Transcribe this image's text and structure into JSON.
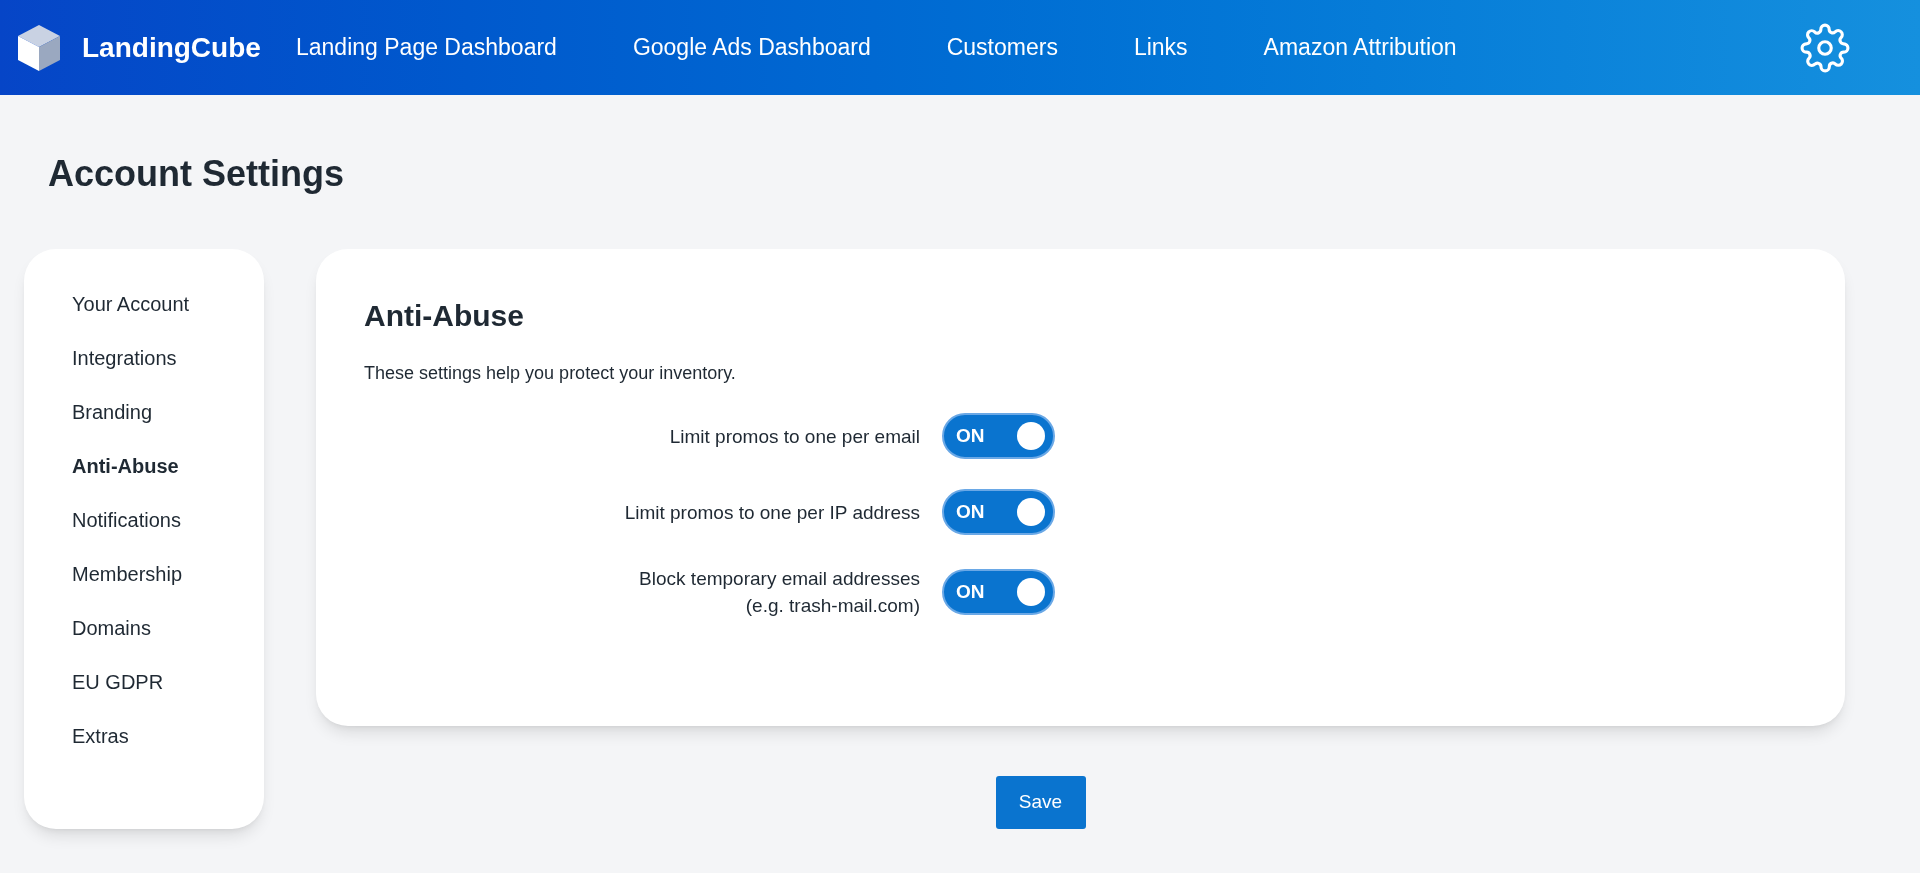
{
  "brand": "LandingCube",
  "nav": [
    "Landing Page Dashboard",
    "Google Ads Dashboard",
    "Customers",
    "Links",
    "Amazon Attribution"
  ],
  "page_title": "Account Settings",
  "sidebar": [
    {
      "label": "Your Account",
      "selected": false
    },
    {
      "label": "Integrations",
      "selected": false
    },
    {
      "label": "Branding",
      "selected": false
    },
    {
      "label": "Anti-Abuse",
      "selected": true
    },
    {
      "label": "Notifications",
      "selected": false
    },
    {
      "label": "Membership",
      "selected": false
    },
    {
      "label": "Domains",
      "selected": false
    },
    {
      "label": "EU GDPR",
      "selected": false
    },
    {
      "label": "Extras",
      "selected": false
    }
  ],
  "section": {
    "title": "Anti-Abuse",
    "description": "These settings help you protect your inventory.",
    "settings": [
      {
        "label": "Limit promos to one per email",
        "toggle": "ON",
        "on": true
      },
      {
        "label": "Limit promos to one per IP address",
        "toggle": "ON",
        "on": true
      },
      {
        "label": "Block temporary email addresses (e.g. trash-mail.com)",
        "toggle": "ON",
        "on": true
      }
    ]
  },
  "save": "Save"
}
